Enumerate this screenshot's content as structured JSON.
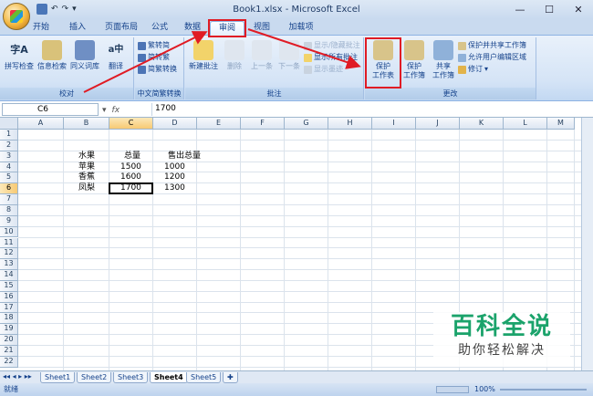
{
  "window": {
    "title": "Book1.xlsx - Microsoft Excel",
    "minimize": "—",
    "maximize": "☐",
    "close": "✕"
  },
  "qat": {
    "undo": "↶",
    "redo": "↷",
    "more": "▾"
  },
  "tabs": [
    "开始",
    "插入",
    "页面布局",
    "公式",
    "数据",
    "审阅",
    "视图",
    "加载项"
  ],
  "active_tab": "审阅",
  "ribbon": {
    "proofing": {
      "label": "校对",
      "buttons": [
        "拼写检查",
        "信息检索",
        "同义词库",
        "翻译"
      ]
    },
    "chinese": {
      "label": "中文简繁转换",
      "buttons": [
        "繁转简",
        "简转繁",
        "简繁转换"
      ]
    },
    "comments": {
      "label": "批注",
      "new": "新建批注",
      "delete": "删除",
      "prev": "上一条",
      "next": "下一条",
      "show_hide": "显示/隐藏批注",
      "show_all": "显示所有批注",
      "show_ink": "显示墨迹"
    },
    "changes": {
      "label": "更改",
      "protect_sheet": [
        "保护",
        "工作表"
      ],
      "protect_book": [
        "保护",
        "工作簿"
      ],
      "share_book": [
        "共享",
        "工作簿"
      ],
      "protect_share": "保护并共享工作簿",
      "allow_edit": "允许用户编辑区域",
      "track": "修订"
    }
  },
  "formula_bar": {
    "name_box": "C6",
    "fx": "fx",
    "value": "1700"
  },
  "columns": [
    "A",
    "B",
    "C",
    "D",
    "E",
    "F",
    "G",
    "H",
    "I",
    "J",
    "K",
    "L",
    "M"
  ],
  "selected_col": "C",
  "selected_row": "6",
  "rows": [
    "1",
    "2",
    "3",
    "4",
    "5",
    "6",
    "7",
    "8",
    "9",
    "10",
    "11",
    "12",
    "13",
    "14",
    "15",
    "16",
    "17",
    "18",
    "19",
    "20",
    "21",
    "22"
  ],
  "cells": [
    {
      "ref": "B3",
      "value": "水果"
    },
    {
      "ref": "C3",
      "value": "总量"
    },
    {
      "ref": "D3",
      "value": "售出总量"
    },
    {
      "ref": "B4",
      "value": "苹果"
    },
    {
      "ref": "C4",
      "value": "1500"
    },
    {
      "ref": "D4",
      "value": "1000"
    },
    {
      "ref": "B5",
      "value": "香蕉"
    },
    {
      "ref": "C5",
      "value": "1600"
    },
    {
      "ref": "D5",
      "value": "1200"
    },
    {
      "ref": "B6",
      "value": "凤梨"
    },
    {
      "ref": "C6",
      "value": "1700"
    },
    {
      "ref": "D6",
      "value": "1300"
    }
  ],
  "sheets": [
    "Sheet1",
    "Sheet2",
    "Sheet3",
    "Sheet4",
    "Sheet5"
  ],
  "active_sheet": "Sheet4",
  "status": {
    "ready": "就绪",
    "zoom": "100%"
  },
  "watermark": {
    "title": "百科全说",
    "subtitle": "助你轻松解决"
  },
  "colors": {
    "accent": "#e01b24",
    "watermark": "#1ba36b"
  }
}
